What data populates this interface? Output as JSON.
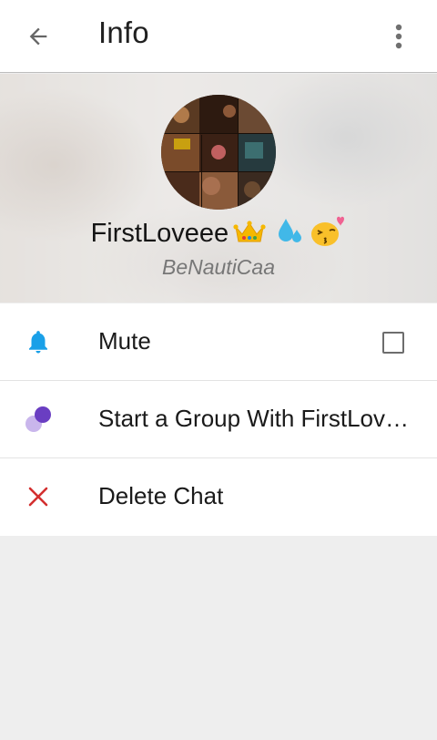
{
  "appbar": {
    "title": "Info",
    "back_icon": "arrow-back-icon",
    "overflow_icon": "more-vertical-icon"
  },
  "profile": {
    "name": "FirstLoveee",
    "name_emojis": [
      "crown",
      "sweat-droplets",
      "kissing-face-with-heart"
    ],
    "username": "BeNautiCaa"
  },
  "actions": [
    {
      "label": "Mute",
      "icon": "bell-icon",
      "checked": false
    },
    {
      "label": "Start a Group With FirstLoveee",
      "icon": "group-dots-icon"
    },
    {
      "label": "Delete Chat",
      "icon": "close-x-icon"
    }
  ],
  "colors": {
    "accent_blue": "#1aa0e8",
    "group_purple": "#6a3ec2",
    "group_purple_light": "#c9b6ec",
    "delete_red": "#d32f2f",
    "background": "#eeeeee"
  }
}
